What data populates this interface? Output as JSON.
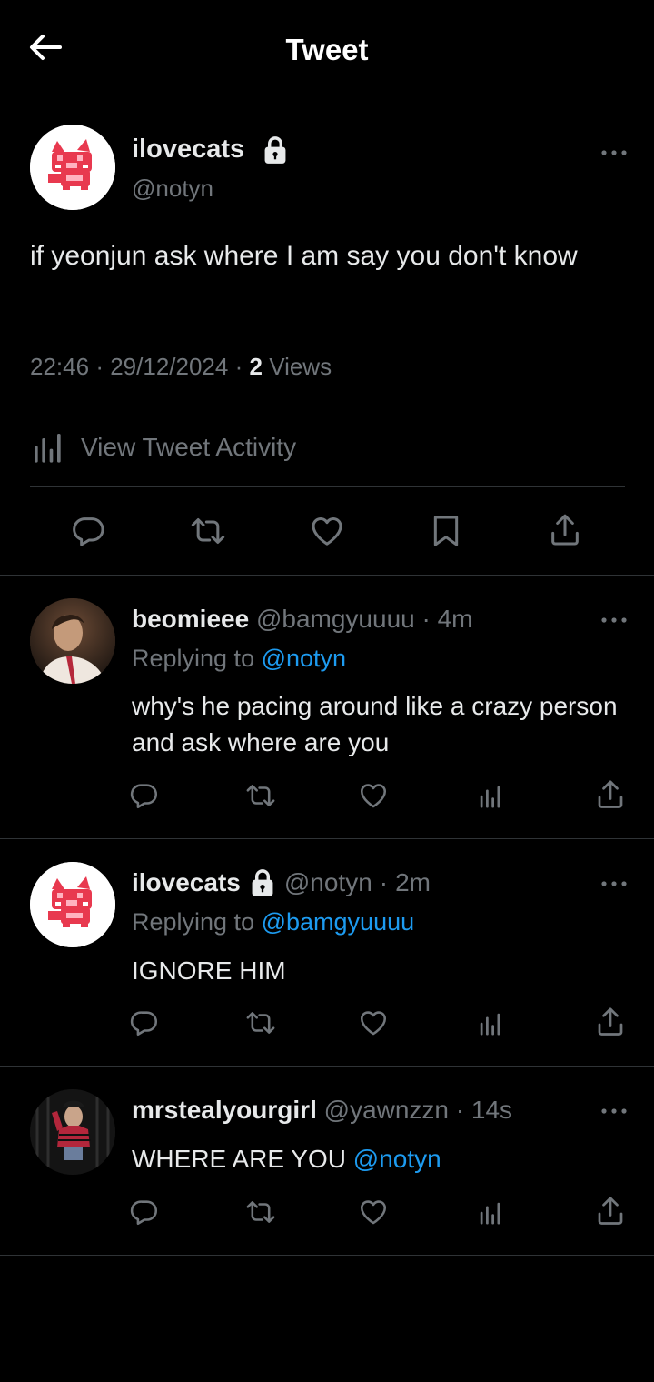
{
  "header": {
    "title": "Tweet"
  },
  "main_tweet": {
    "display_name": "ilovecats",
    "handle": "@notyn",
    "text": "if yeonjun ask where I am say you don't know",
    "time": "22:46",
    "date": "29/12/2024",
    "views_count": "2",
    "views_label": "Views",
    "dot": "·",
    "activity_label": "View Tweet Activity"
  },
  "replies": [
    {
      "display_name": "beomieee",
      "handle": "@bamgyuuuu",
      "age": "4m",
      "replying_prefix": "Replying to",
      "replying_to": "@notyn",
      "text": "why's he pacing around like a crazy person and ask where are you"
    },
    {
      "display_name": "ilovecats",
      "handle": "@notyn",
      "age": "2m",
      "replying_prefix": "Replying to",
      "replying_to": "@bamgyuuuu",
      "text": "IGNORE HIM"
    },
    {
      "display_name": "mrstealyourgirl",
      "handle": "@yawnzzn",
      "age": "14s",
      "text": "WHERE ARE YOU",
      "mention": "@notyn"
    }
  ],
  "icons": {
    "back": "arrow-left-icon",
    "lock": "lock-icon",
    "more": "more-horizontal-icon",
    "activity": "bar-chart-icon",
    "reply": "comment-icon",
    "retweet": "retweet-icon",
    "like": "heart-icon",
    "bookmark": "bookmark-icon",
    "share": "share-icon"
  },
  "colors": {
    "background": "#000000",
    "link": "#1d9bf0",
    "muted": "#71767b",
    "text": "#e7e9ea"
  }
}
